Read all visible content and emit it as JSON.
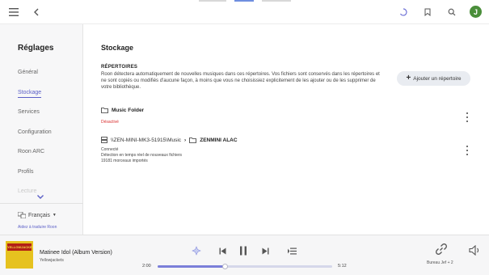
{
  "settings": {
    "title": "Réglages",
    "nav": [
      {
        "label": "Général"
      },
      {
        "label": "Stockage"
      },
      {
        "label": "Services"
      },
      {
        "label": "Configuration"
      },
      {
        "label": "Roon ARC"
      },
      {
        "label": "Profils"
      },
      {
        "label": "Lecture"
      }
    ],
    "language": "Français",
    "help_link": "Aidez à traduire Roon"
  },
  "storage": {
    "title": "Stockage",
    "section_title": "RÉPERTOIRES",
    "description": "Roon détectera automatiquement de nouvelles musiques dans ces répertoires. Vos fichiers sont conservés dans les répertoires et ne sont copiés ou modifiés d'aucune façon, à moins que vous ne choisissiez explicitement de les ajouter ou de les supprimer de votre bibliothèque.",
    "add_button": "Ajouter un répertoire",
    "folders": [
      {
        "name": "Music Folder",
        "status": "Désactivé"
      },
      {
        "path": "\\\\ZEN-MINI-MK3-51915\\Music",
        "name": "ZENMINI ALAC",
        "status": "Connecté",
        "detection": "Détection en temps réel de nouveaux fichiers",
        "count": "19181 morceaux importés"
      }
    ]
  },
  "player": {
    "track": "Matinee Idol (Album Version)",
    "artist": "Yellowjackets",
    "cover_text": "YELLOWJACKETS",
    "elapsed": "2:00",
    "duration": "5:12",
    "progress": 0.385,
    "zone": "Bureau Jef + 2"
  },
  "avatar_letter": "J",
  "colors": {
    "accent": "#5b5fc7",
    "disabled": "#d93030",
    "avatar": "#4a8e3a"
  }
}
